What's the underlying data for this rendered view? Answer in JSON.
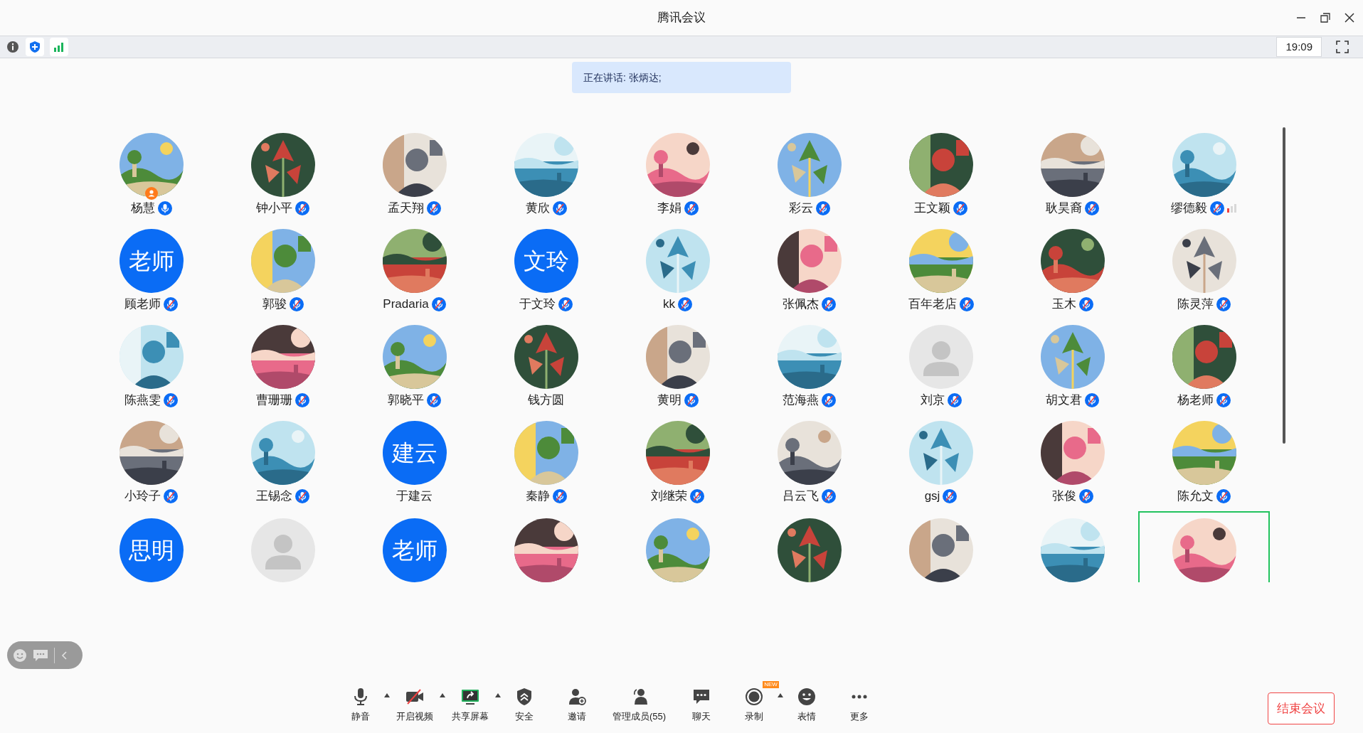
{
  "window": {
    "title": "腾讯会议"
  },
  "info_bar": {
    "time": "19:09"
  },
  "speaking_banner": "正在讲话: 张炳达;",
  "participants": [
    {
      "name": "杨慧",
      "kind": "picture",
      "muted": false,
      "host": true,
      "weak_signal": false
    },
    {
      "name": "钟小平",
      "kind": "picture",
      "muted": true,
      "host": false,
      "weak_signal": false
    },
    {
      "name": "孟天翔",
      "kind": "picture",
      "muted": true,
      "host": false,
      "weak_signal": false
    },
    {
      "name": "黄欣",
      "kind": "picture",
      "muted": true,
      "host": false,
      "weak_signal": false
    },
    {
      "name": "李娟",
      "kind": "picture",
      "muted": true,
      "host": false,
      "weak_signal": false
    },
    {
      "name": "彩云",
      "kind": "picture",
      "muted": true,
      "host": false,
      "weak_signal": false
    },
    {
      "name": "王文颖",
      "kind": "picture",
      "muted": true,
      "host": false,
      "weak_signal": false
    },
    {
      "name": "耿昊裔",
      "kind": "picture",
      "muted": true,
      "host": false,
      "weak_signal": false
    },
    {
      "name": "缪德毅",
      "kind": "picture",
      "muted": true,
      "host": false,
      "weak_signal": true
    },
    {
      "name": "顾老师",
      "kind": "text",
      "avatar_text": "老师",
      "muted": true,
      "host": false,
      "weak_signal": false
    },
    {
      "name": "郭骏",
      "kind": "picture",
      "muted": true,
      "host": false,
      "weak_signal": false
    },
    {
      "name": "Pradaria",
      "kind": "picture",
      "muted": true,
      "host": false,
      "weak_signal": false
    },
    {
      "name": "于文玲",
      "kind": "text",
      "avatar_text": "文玲",
      "muted": true,
      "host": false,
      "weak_signal": false
    },
    {
      "name": "kk",
      "kind": "picture",
      "muted": true,
      "host": false,
      "weak_signal": false
    },
    {
      "name": "张佩杰",
      "kind": "picture",
      "muted": true,
      "host": false,
      "weak_signal": false
    },
    {
      "name": "百年老店",
      "kind": "picture",
      "muted": true,
      "host": false,
      "weak_signal": false
    },
    {
      "name": "玉木",
      "kind": "picture",
      "muted": true,
      "host": false,
      "weak_signal": false
    },
    {
      "name": "陈灵萍",
      "kind": "picture",
      "muted": true,
      "host": false,
      "weak_signal": false
    },
    {
      "name": "陈燕雯",
      "kind": "picture",
      "muted": true,
      "host": false,
      "weak_signal": false
    },
    {
      "name": "曹珊珊",
      "kind": "picture",
      "muted": true,
      "host": false,
      "weak_signal": false
    },
    {
      "name": "郭晓平",
      "kind": "picture",
      "muted": true,
      "host": false,
      "weak_signal": false
    },
    {
      "name": "钱方圆",
      "kind": "picture",
      "host": false,
      "weak_signal": false
    },
    {
      "name": "黄明",
      "kind": "picture",
      "muted": true,
      "host": false,
      "weak_signal": false
    },
    {
      "name": "范海燕",
      "kind": "picture",
      "muted": true,
      "host": false,
      "weak_signal": false
    },
    {
      "name": "刘京",
      "kind": "default",
      "muted": true,
      "host": false,
      "weak_signal": false
    },
    {
      "name": "胡文君",
      "kind": "picture",
      "muted": true,
      "host": false,
      "weak_signal": false
    },
    {
      "name": "杨老师",
      "kind": "picture",
      "muted": true,
      "host": false,
      "weak_signal": false
    },
    {
      "name": "小玲子",
      "kind": "picture",
      "muted": true,
      "host": false,
      "weak_signal": false
    },
    {
      "name": "王锡念",
      "kind": "picture",
      "muted": true,
      "host": false,
      "weak_signal": false
    },
    {
      "name": "于建云",
      "kind": "text",
      "avatar_text": "建云",
      "host": false,
      "weak_signal": false
    },
    {
      "name": "秦静",
      "kind": "picture",
      "muted": true,
      "host": false,
      "weak_signal": false
    },
    {
      "name": "刘继荣",
      "kind": "picture",
      "muted": true,
      "host": false,
      "weak_signal": false
    },
    {
      "name": "吕云飞",
      "kind": "picture",
      "muted": true,
      "host": false,
      "weak_signal": false
    },
    {
      "name": "gsj",
      "kind": "picture",
      "muted": true,
      "host": false,
      "weak_signal": false
    },
    {
      "name": "张俊",
      "kind": "picture",
      "muted": true,
      "host": false,
      "weak_signal": false
    },
    {
      "name": "陈允文",
      "kind": "picture",
      "muted": true,
      "host": false,
      "weak_signal": false
    },
    {
      "kind": "text",
      "avatar_text": "思明",
      "host": false,
      "weak_signal": false,
      "selected": false
    },
    {
      "kind": "default",
      "host": false,
      "weak_signal": false,
      "selected": false
    },
    {
      "kind": "text",
      "avatar_text": "老师",
      "host": false,
      "weak_signal": false,
      "selected": false
    },
    {
      "kind": "picture",
      "host": false,
      "weak_signal": false,
      "selected": false
    },
    {
      "kind": "picture",
      "host": false,
      "weak_signal": false,
      "selected": false
    },
    {
      "kind": "picture",
      "host": false,
      "weak_signal": false,
      "selected": false
    },
    {
      "kind": "picture",
      "host": false,
      "weak_signal": false,
      "selected": false
    },
    {
      "kind": "picture",
      "host": false,
      "weak_signal": false,
      "selected": false
    },
    {
      "kind": "picture",
      "host": false,
      "weak_signal": false,
      "selected": true
    }
  ],
  "toolbar": [
    {
      "label": "静音",
      "kind": "mic",
      "caret": true
    },
    {
      "label": "开启视频",
      "kind": "video",
      "caret": true
    },
    {
      "label": "共享屏幕",
      "kind": "share",
      "caret": true
    },
    {
      "label": "安全",
      "kind": "security",
      "caret": false
    },
    {
      "label": "邀请",
      "kind": "invite",
      "caret": false
    },
    {
      "label": "管理成员(55)",
      "kind": "members",
      "caret": false
    },
    {
      "label": "聊天",
      "kind": "chat",
      "caret": false
    },
    {
      "label": "录制",
      "kind": "record",
      "caret": true,
      "badge": "NEW"
    },
    {
      "label": "表情",
      "kind": "reaction",
      "caret": false
    },
    {
      "label": "更多",
      "kind": "more",
      "caret": false
    }
  ],
  "end_button": "结束会议"
}
